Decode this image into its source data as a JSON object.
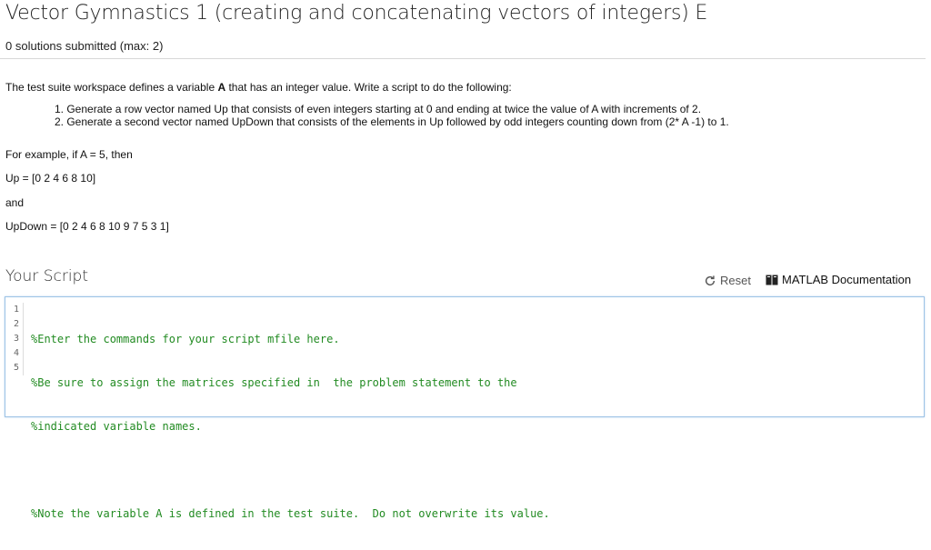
{
  "header": {
    "title": "Vector Gymnastics 1 (creating and concatenating vectors of integers) E",
    "submissions": "0 solutions submitted (max: 2)"
  },
  "problem": {
    "intro_before": "The test suite workspace defines a variable ",
    "intro_var": "A",
    "intro_after": " that has an integer value. Write a script to do the following:",
    "steps": [
      "1. Generate a row vector named Up that consists of even integers starting at 0 and ending at twice the value of A with increments of 2.",
      "2. Generate a second vector named UpDown that consists of the elements in Up followed by odd integers counting down from (2* A -1) to 1."
    ],
    "example": "For example, if A = 5, then",
    "up_line": "Up = [0 2 4 6 8 10]",
    "and": "and",
    "updown_line": "UpDown = [0 2 4 6 8 10 9 7 5 3 1]"
  },
  "script_panel": {
    "heading": "Your Script",
    "reset_label": "Reset",
    "reset_icon": "refresh-icon",
    "doc_label": "MATLAB Documentation",
    "doc_icon": "book-icon",
    "line_numbers": [
      "1",
      "2",
      "3",
      "4",
      "5"
    ],
    "code_lines": [
      "%Enter the commands for your script mfile here.",
      "%Be sure to assign the matrices specified in  the problem statement to the",
      "%indicated variable names.",
      "",
      "%Note the variable A is defined in the test suite.  Do not overwrite its value."
    ],
    "code_color": "#228b22"
  }
}
